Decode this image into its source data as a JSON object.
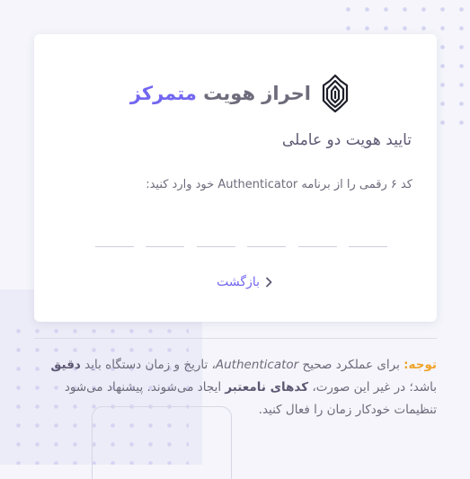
{
  "brand": {
    "title_part1": "احراز هویت",
    "title_part2": "متمرکز",
    "logo_icon": "shield-lotus-logo"
  },
  "card": {
    "heading": "تایید هویت دو عاملی",
    "instruction": "کد ۶ رقمی را از برنامه Authenticator خود وارد کنید:",
    "otp": {
      "length": 6,
      "values": [
        "",
        "",
        "",
        "",
        "",
        ""
      ]
    },
    "back_label": "بازگشت",
    "back_icon": "chevron-right-icon"
  },
  "note": {
    "label": "توجه:",
    "seg1": " برای عملکرد صحیح ",
    "app_name": "Authenticator",
    "seg2": "، تاریخ و زمان دستگاه باید ",
    "bold1": "دقیق",
    "seg3": " باشد؛ در غیر این صورت، ",
    "bold2": "کدهای نامعتبر",
    "seg4": " ایجاد می‌شوند. پیشنهاد می‌شود تنظیمات خودکار زمان را فعال کنید."
  },
  "colors": {
    "accent": "#7367f0",
    "warning": "#f0a429",
    "text": "#6e6b7b",
    "background": "#f5f5fb"
  }
}
